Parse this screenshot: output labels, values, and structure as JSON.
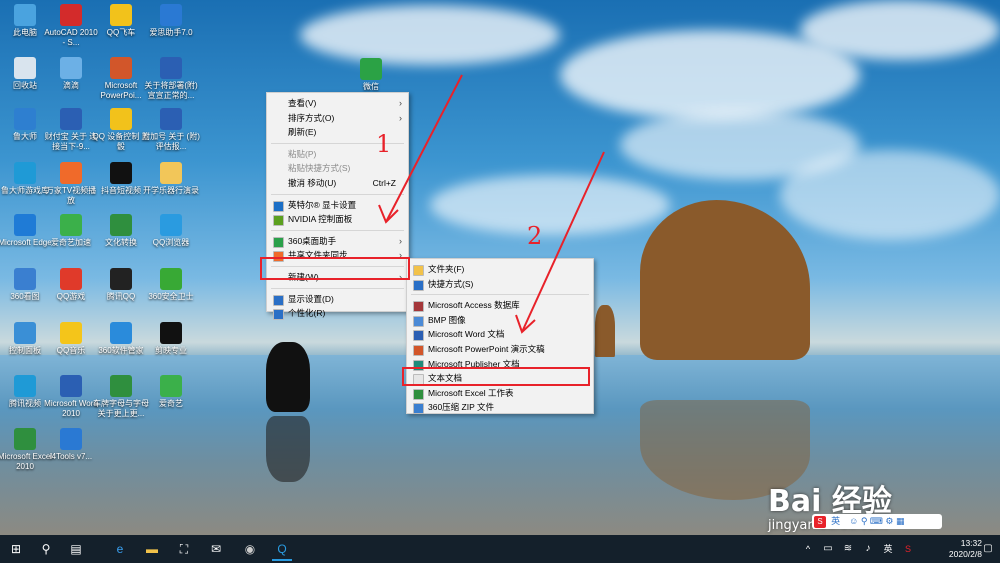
{
  "desktop_icons": [
    {
      "label": "此电脑",
      "color": "#4aa3df"
    },
    {
      "label": "AutoCAD 2010 - S...",
      "color": "#d32b2b"
    },
    {
      "label": "QQ飞车",
      "color": "#f2c21b"
    },
    {
      "label": "爱思助手7.0",
      "color": "#2a79d3"
    },
    {
      "label": "回收站",
      "color": "#d9e4ee"
    },
    {
      "label": "滴滴",
      "color": "#6cb0e6"
    },
    {
      "label": "Microsoft PowerPoi...",
      "color": "#d2562a"
    },
    {
      "label": "关于将部署(附) 宣宣正常的...",
      "color": "#2b5fb3"
    },
    {
      "label": "鲁大师",
      "color": "#2e7fd0"
    },
    {
      "label": "财付宝 关于 连接当下-9...",
      "color": "#2b5fb3"
    },
    {
      "label": "QQ 设备控制 五骰",
      "color": "#f2c21b"
    },
    {
      "label": "附加号 关于 (附)评估报...",
      "color": "#2b5fb3"
    },
    {
      "label": "鲁大师游戏库",
      "color": "#1f9ad6"
    },
    {
      "label": "万家TV视频播放",
      "color": "#f06a2a"
    },
    {
      "label": "抖音短视频",
      "color": "#111111"
    },
    {
      "label": "开学乐器行演录",
      "color": "#f2c659"
    },
    {
      "label": "Microsoft Edge",
      "color": "#1f7bd6"
    },
    {
      "label": "爱奇艺加速",
      "color": "#3bb04a"
    },
    {
      "label": "文化转换",
      "color": "#2f8f3e"
    },
    {
      "label": "QQ浏览器",
      "color": "#2a9be0"
    },
    {
      "label": "360看图",
      "color": "#3a7fd0"
    },
    {
      "label": "QQ游戏",
      "color": "#e03a2a"
    },
    {
      "label": "腾讯QQ",
      "color": "#222222"
    },
    {
      "label": "360安全卫士",
      "color": "#38a935"
    },
    {
      "label": "控制面板",
      "color": "#3a8fd6"
    },
    {
      "label": "QQ音乐",
      "color": "#f4c51a"
    },
    {
      "label": "360软件管家",
      "color": "#2a8bdb"
    },
    {
      "label": "剪映专业",
      "color": "#111111"
    },
    {
      "label": "腾讯视频",
      "color": "#1f9ad6"
    },
    {
      "label": "Microsoft Word 2010",
      "color": "#2b5fb3"
    },
    {
      "label": "车牌字母与字母 关于更上更...",
      "color": "#2f8f3e"
    },
    {
      "label": "爱奇艺",
      "color": "#3bb04a"
    },
    {
      "label": "Microsoft Excel 2010",
      "color": "#2f8f3e"
    },
    {
      "label": "i4Tools v7...",
      "color": "#2a79d3"
    }
  ],
  "desktop_extra_icon": {
    "label": "微信",
    "color": "#2ba245"
  },
  "context_menu": {
    "items": [
      {
        "label": "查看(V)",
        "submenu": true
      },
      {
        "label": "排序方式(O)",
        "submenu": true
      },
      {
        "label": "刷新(E)"
      },
      {
        "label": "粘贴(P)",
        "disabled": true
      },
      {
        "label": "粘贴快捷方式(S)",
        "disabled": true
      },
      {
        "label": "撤消 移动(U)",
        "shortcut": "Ctrl+Z"
      },
      {
        "label": "英特尔® 显卡设置",
        "icon": "intel-icon",
        "icon_color": "#1c6fc6"
      },
      {
        "label": "NVIDIA 控制面板",
        "icon": "nvidia-icon",
        "icon_color": "#5ca01f"
      },
      {
        "label": "360桌面助手",
        "submenu": true,
        "icon": "360-icon",
        "icon_color": "#2aa04a"
      },
      {
        "label": "共享文件夹同步",
        "submenu": true,
        "icon": "sync-icon",
        "icon_color": "#f06a2a"
      },
      {
        "label": "新建(W)",
        "submenu": true
      },
      {
        "label": "显示设置(D)",
        "icon": "display-icon",
        "icon_color": "#2a6fc6"
      },
      {
        "label": "个性化(R)",
        "icon": "personalize-icon",
        "icon_color": "#2a6fc6"
      }
    ]
  },
  "new_submenu": {
    "items": [
      {
        "label": "文件夹(F)",
        "icon": "folder-icon",
        "icon_color": "#f2c24a"
      },
      {
        "label": "快捷方式(S)",
        "icon": "shortcut-icon",
        "icon_color": "#2a6fc6"
      },
      {
        "label": "Microsoft Access 数据库",
        "icon": "access-icon",
        "icon_color": "#a4373a"
      },
      {
        "label": "BMP 图像",
        "icon": "bmp-icon",
        "icon_color": "#4b8ad6"
      },
      {
        "label": "Microsoft Word 文档",
        "icon": "word-icon",
        "icon_color": "#2b5fb3"
      },
      {
        "label": "Microsoft PowerPoint 演示文稿",
        "icon": "ppt-icon",
        "icon_color": "#d2562a"
      },
      {
        "label": "Microsoft Publisher 文档",
        "icon": "publisher-icon",
        "icon_color": "#1f8a7a"
      },
      {
        "label": "文本文档",
        "icon": "text-file-icon",
        "icon_color": "#e6e6e6"
      },
      {
        "label": "Microsoft Excel 工作表",
        "icon": "excel-icon",
        "icon_color": "#2f8f3e"
      },
      {
        "label": "360压缩 ZIP 文件",
        "icon": "zip-icon",
        "icon_color": "#3a7fd0"
      }
    ]
  },
  "annotations": {
    "one": "1",
    "two": "2"
  },
  "taskbar": {
    "time": "13:32",
    "date": "2020/2/8",
    "ime": "英",
    "ime_tray": "英",
    "tray_badge": "S",
    "accent": "#e8222a"
  },
  "watermark": {
    "brand": "Bai 经验",
    "url": "jingyan.baidu.com"
  }
}
